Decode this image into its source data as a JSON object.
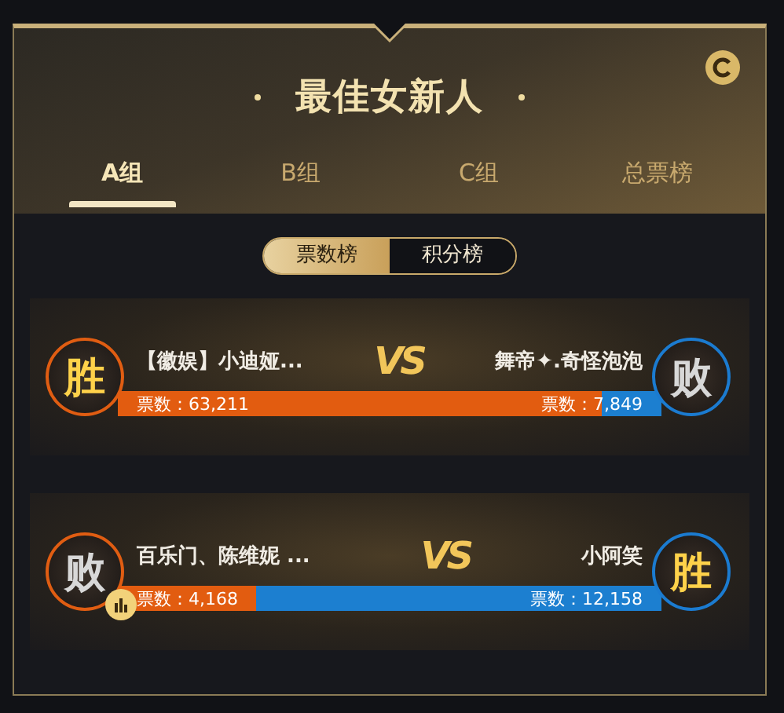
{
  "title": "最佳女新人",
  "tabs": [
    {
      "label": "A组",
      "selected": true
    },
    {
      "label": "B组",
      "selected": false
    },
    {
      "label": "C组",
      "selected": false
    },
    {
      "label": "总票榜",
      "selected": false
    }
  ],
  "toggle": [
    {
      "label": "票数榜",
      "selected": true
    },
    {
      "label": "积分榜",
      "selected": false
    }
  ],
  "matches": [
    {
      "vs": "VS",
      "level": 0.8895,
      "stats_icon": false,
      "left": {
        "name": "【徽娱】小迪娅...",
        "result": "胜",
        "votes": "票数：63,211"
      },
      "right": {
        "name": "舞帝✦.奇怪泡泡",
        "result": "败",
        "votes": "票数：7,849"
      }
    },
    {
      "vs": "VS",
      "level": 0.2553,
      "stats_icon": true,
      "left": {
        "name": "百乐门、陈维妮 ...",
        "result": "败",
        "votes": "票数：4,168"
      },
      "right": {
        "name": "小阿笑",
        "result": "胜",
        "votes": "票数：12,158"
      }
    }
  ]
}
